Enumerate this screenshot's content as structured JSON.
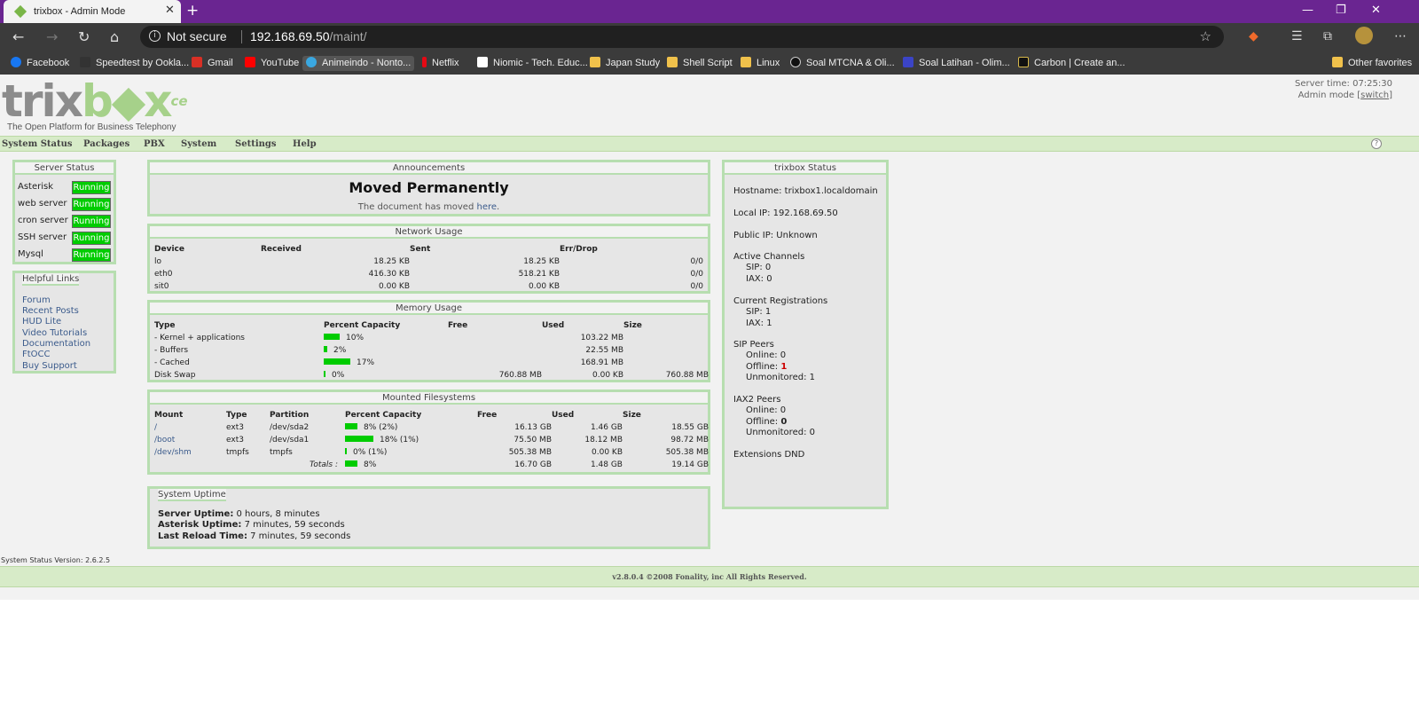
{
  "browser": {
    "tab_title": "trixbox - Admin Mode",
    "security": "Not secure",
    "url_host": "192.168.69.50",
    "url_path": "/maint/",
    "bookmarks": [
      "Facebook",
      "Speedtest by Ookla...",
      "Gmail",
      "YouTube",
      "Animeindo - Nonto...",
      "Netflix",
      "Niomic - Tech. Educ...",
      "Japan Study",
      "Shell Script",
      "Linux",
      "Soal MTCNA & Oli...",
      "Soal Latihan - Olim...",
      "Carbon | Create an..."
    ],
    "other_favorites": "Other favorites"
  },
  "header": {
    "logo_a": "trix",
    "logo_b": "b",
    "logo_c": "x",
    "logo_ce": "ce",
    "tagline": "The Open Platform for Business Telephony",
    "server_time": "Server time: 07:25:30",
    "admin_mode": "Admin mode",
    "switch": "switch"
  },
  "menu": [
    "System Status",
    "Packages",
    "PBX",
    "System",
    "Settings",
    "Help"
  ],
  "server_status": {
    "title": "Server Status",
    "services": [
      {
        "name": "Asterisk",
        "status": "Running"
      },
      {
        "name": "web server",
        "status": "Running"
      },
      {
        "name": "cron server",
        "status": "Running"
      },
      {
        "name": "SSH server",
        "status": "Running"
      },
      {
        "name": "Mysql",
        "status": "Running"
      }
    ]
  },
  "helpful_links": {
    "title": "Helpful Links",
    "items": [
      "Forum",
      "Recent Posts",
      "HUD Lite",
      "Video Tutorials",
      "Documentation",
      "FtOCC",
      "Buy Support"
    ]
  },
  "announcements": {
    "title": "Announcements",
    "heading": "Moved Permanently",
    "text": "The document has moved",
    "link": "here",
    "period": "."
  },
  "network": {
    "title": "Network Usage",
    "headers": [
      "Device",
      "Received",
      "Sent",
      "Err/Drop"
    ],
    "rows": [
      [
        "lo",
        "18.25 KB",
        "18.25 KB",
        "0/0"
      ],
      [
        "eth0",
        "416.30 KB",
        "518.21 KB",
        "0/0"
      ],
      [
        "sit0",
        "0.00 KB",
        "0.00 KB",
        "0/0"
      ]
    ]
  },
  "memory": {
    "title": "Memory Usage",
    "headers": [
      "Type",
      "Percent Capacity",
      "Free",
      "Used",
      "Size"
    ],
    "rows": [
      {
        "type": "- Kernel + applications",
        "pct": 10,
        "pct_text": "10%",
        "free": "",
        "used": "103.22 MB",
        "size": ""
      },
      {
        "type": "- Buffers",
        "pct": 2,
        "pct_text": "2%",
        "free": "",
        "used": "22.55 MB",
        "size": ""
      },
      {
        "type": "- Cached",
        "pct": 17,
        "pct_text": "17%",
        "free": "",
        "used": "168.91 MB",
        "size": ""
      },
      {
        "type": "Disk Swap",
        "pct": 0,
        "pct_text": "0%",
        "free": "760.88 MB",
        "used": "0.00 KB",
        "size": "760.88 MB"
      }
    ]
  },
  "filesystems": {
    "title": "Mounted Filesystems",
    "headers": [
      "Mount",
      "Type",
      "Partition",
      "Percent Capacity",
      "Free",
      "Used",
      "Size"
    ],
    "rows": [
      {
        "mount": "/",
        "type": "ext3",
        "partition": "/dev/sda2",
        "pct": 8,
        "pct_text": "8% (2%)",
        "free": "16.13 GB",
        "used": "1.46 GB",
        "size": "18.55 GB"
      },
      {
        "mount": "/boot",
        "type": "ext3",
        "partition": "/dev/sda1",
        "pct": 18,
        "pct_text": "18% (1%)",
        "free": "75.50 MB",
        "used": "18.12 MB",
        "size": "98.72 MB"
      },
      {
        "mount": "/dev/shm",
        "type": "tmpfs",
        "partition": "tmpfs",
        "pct": 0,
        "pct_text": "0% (1%)",
        "free": "505.38 MB",
        "used": "0.00 KB",
        "size": "505.38 MB"
      }
    ],
    "totals_label": "Totals :",
    "totals": {
      "pct": 8,
      "pct_text": "8%",
      "free": "16.70 GB",
      "used": "1.48 GB",
      "size": "19.14 GB"
    }
  },
  "uptime": {
    "title": "System Uptime",
    "rows": [
      {
        "label": "Server Uptime:",
        "value": "0 hours, 8 minutes"
      },
      {
        "label": "Asterisk Uptime:",
        "value": "7 minutes, 59 seconds"
      },
      {
        "label": "Last Reload Time:",
        "value": "7 minutes, 59 seconds"
      }
    ]
  },
  "trixbox_status": {
    "title": "trixbox Status",
    "hostname": "Hostname: trixbox1.localdomain",
    "local_ip": "Local IP: 192.168.69.50",
    "public_ip": "Public IP: Unknown",
    "active_channels": "Active Channels",
    "ac_sip": "SIP: 0",
    "ac_iax": "IAX: 0",
    "current_reg": "Current Registrations",
    "cr_sip": "SIP: 1",
    "cr_iax": "IAX: 1",
    "sip_peers": "SIP Peers",
    "sip_online": "Online: 0",
    "sip_offline_label": "Offline: ",
    "sip_offline_value": "1",
    "sip_unmon": "Unmonitored: 1",
    "iax_peers": "IAX2 Peers",
    "iax_online": "Online: 0",
    "iax_offline_label": "Offline: ",
    "iax_offline_value": "0",
    "iax_unmon": "Unmonitored: 0",
    "extensions": "Extensions DND"
  },
  "footer": {
    "version": "System Status Version: 2.6.2.5",
    "copyright": "v2.8.0.4 ©2008 Fonality, inc All Rights Reserved."
  },
  "colors": {
    "running": "#00cc00",
    "accent_green": "#b7deb0",
    "titlebar": "#6a2591",
    "offline_red": "#cc0000"
  }
}
